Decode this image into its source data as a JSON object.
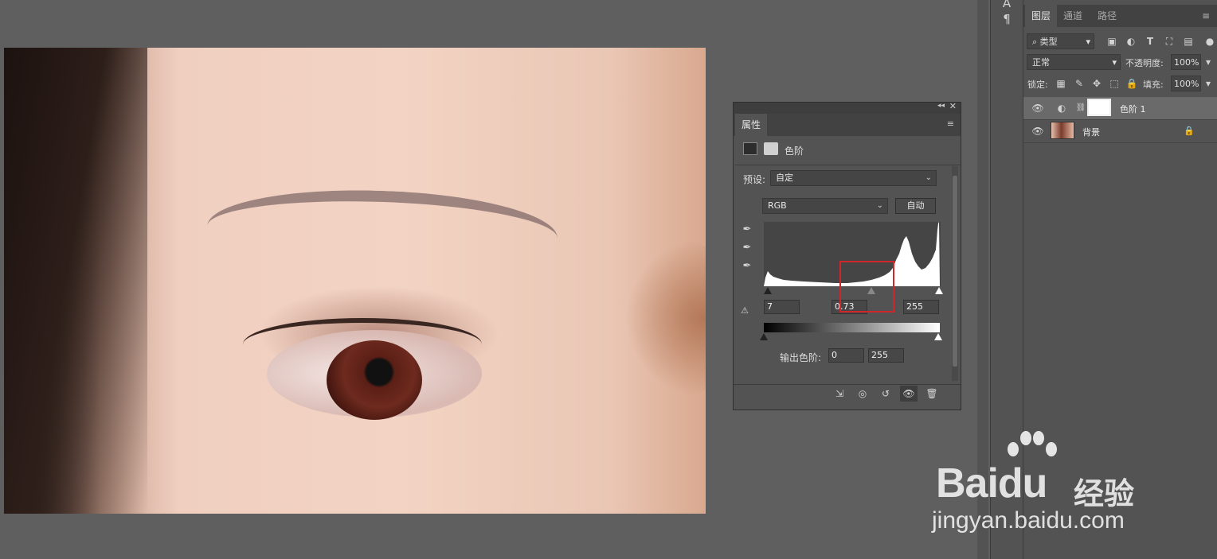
{
  "layers_panel": {
    "tabs": [
      "图层",
      "通道",
      "路径"
    ],
    "filter_kind": "类型",
    "blend_mode": "正常",
    "opacity_label": "不透明度:",
    "opacity_value": "100%",
    "lock_label": "锁定:",
    "fill_label": "填充:",
    "fill_value": "100%",
    "layers": [
      {
        "name": "色阶 1",
        "type": "adjustment",
        "visible": true,
        "selected": true
      },
      {
        "name": "背景",
        "type": "image",
        "visible": true,
        "locked": true
      }
    ]
  },
  "properties": {
    "tab": "属性",
    "adjustment_name": "色阶",
    "preset_label": "预设:",
    "preset_value": "自定",
    "channel": "RGB",
    "auto_button": "自动",
    "input_black": "7",
    "input_gamma": "0.73",
    "input_white": "255",
    "output_label": "输出色阶:",
    "output_black": "0",
    "output_white": "255"
  },
  "highlight_color": "#d0262b",
  "watermark": {
    "brand": "Baidu",
    "suffix": "经验",
    "url": "jingyan.baidu.com"
  }
}
